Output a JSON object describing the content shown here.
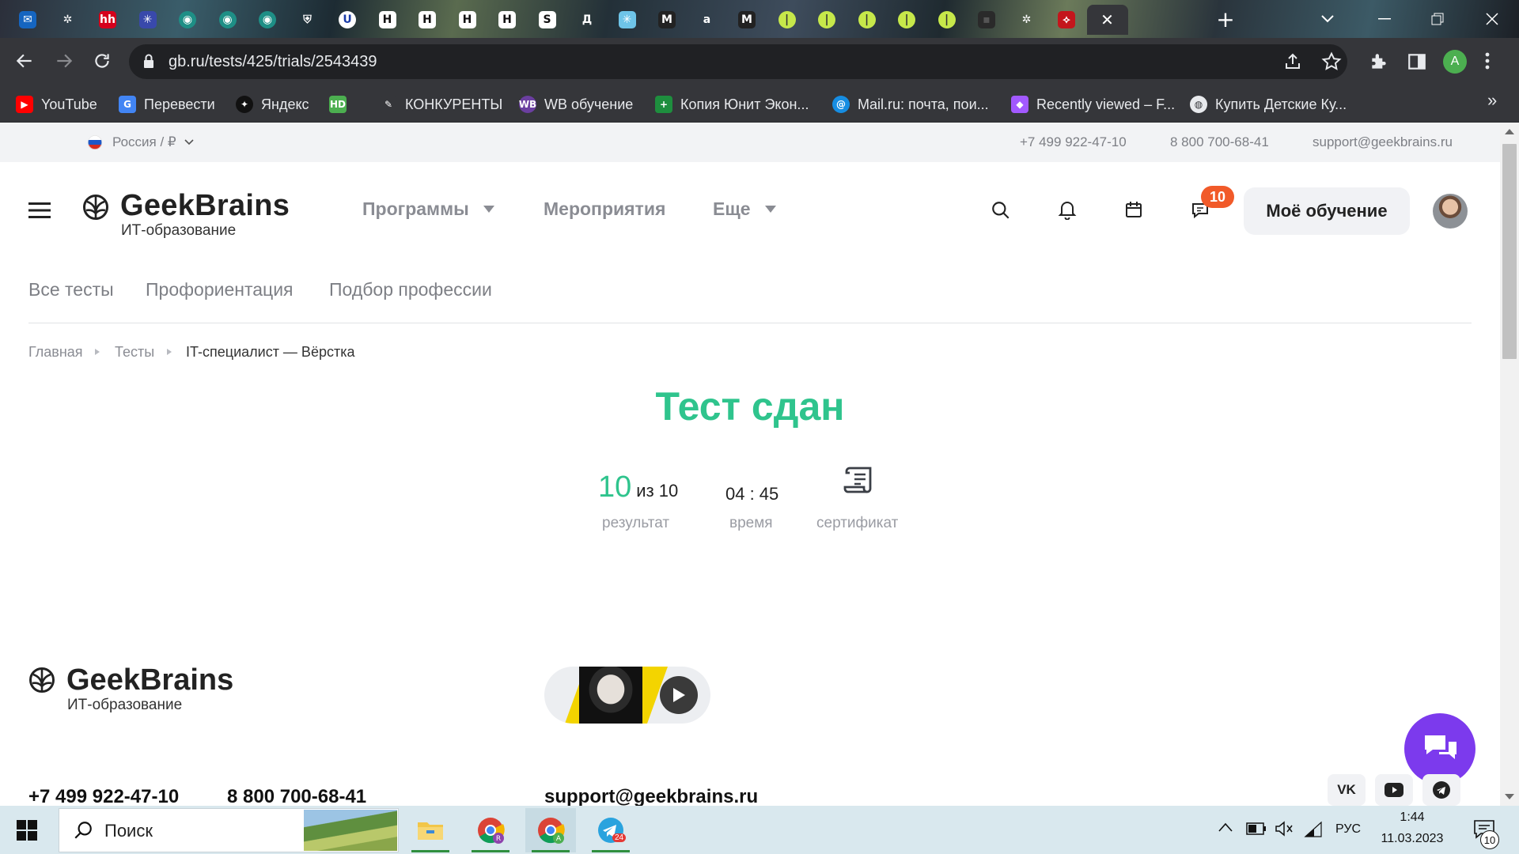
{
  "browser": {
    "tabs": [
      {
        "icon": "mail-icon",
        "glyph": "✉",
        "bg": "#1565c0",
        "fg": "#fff"
      },
      {
        "icon": "openai-icon",
        "glyph": "✲",
        "bg": "transparent",
        "fg": "#fff"
      },
      {
        "icon": "hh-icon",
        "glyph": "hh",
        "bg": "#d6001c",
        "fg": "#fff"
      },
      {
        "icon": "puzzle-icon",
        "glyph": "✳",
        "bg": "#3949ab",
        "fg": "#fff"
      },
      {
        "icon": "teal-circle-icon",
        "glyph": "◉",
        "bg": "#1e8f86",
        "fg": "#fff"
      },
      {
        "icon": "teal-circle-icon",
        "glyph": "◉",
        "bg": "#1e8f86",
        "fg": "#fff"
      },
      {
        "icon": "teal-circle-icon",
        "glyph": "◉",
        "bg": "#1e8f86",
        "fg": "#fff"
      },
      {
        "icon": "shield-icon",
        "glyph": "⛨",
        "bg": "transparent",
        "fg": "#fff"
      },
      {
        "icon": "u-icon",
        "glyph": "U",
        "bg": "#fff",
        "fg": "#1a3ca8"
      },
      {
        "icon": "h-icon",
        "glyph": "H",
        "bg": "#fff",
        "fg": "#111"
      },
      {
        "icon": "h-icon",
        "glyph": "H",
        "bg": "#fff",
        "fg": "#111"
      },
      {
        "icon": "h-icon",
        "glyph": "H",
        "bg": "#fff",
        "fg": "#111"
      },
      {
        "icon": "h-icon",
        "glyph": "H",
        "bg": "#fff",
        "fg": "#111"
      },
      {
        "icon": "link-icon",
        "glyph": "S",
        "bg": "#fff",
        "fg": "#111"
      },
      {
        "icon": "d-icon",
        "glyph": "Д",
        "bg": "transparent",
        "fg": "#fff"
      },
      {
        "icon": "sparkle-icon",
        "glyph": "✳",
        "bg": "#6ec4e8",
        "fg": "#fff"
      },
      {
        "icon": "m-icon",
        "glyph": "M",
        "bg": "#222",
        "fg": "#fff"
      },
      {
        "icon": "a-icon",
        "glyph": "a",
        "bg": "transparent",
        "fg": "#fff"
      },
      {
        "icon": "m-icon",
        "glyph": "M",
        "bg": "#222",
        "fg": "#fff"
      },
      {
        "icon": "lime-circle-icon",
        "glyph": "|",
        "bg": "#c6e84a",
        "fg": "#333"
      },
      {
        "icon": "lime-circle-icon",
        "glyph": "|",
        "bg": "#c6e84a",
        "fg": "#333"
      },
      {
        "icon": "lime-circle-icon",
        "glyph": "|",
        "bg": "#c6e84a",
        "fg": "#333"
      },
      {
        "icon": "lime-circle-icon",
        "glyph": "|",
        "bg": "#c6e84a",
        "fg": "#333"
      },
      {
        "icon": "lime-circle-icon",
        "glyph": "|",
        "bg": "#c6e84a",
        "fg": "#333"
      },
      {
        "icon": "dark-square-icon",
        "glyph": "▪",
        "bg": "#2a2a2a",
        "fg": "#555"
      },
      {
        "icon": "openai-icon",
        "glyph": "✲",
        "bg": "transparent",
        "fg": "#fff"
      },
      {
        "icon": "pdf-icon",
        "glyph": "⟡",
        "bg": "#c4161c",
        "fg": "#fff"
      }
    ],
    "active_tab_close": "✕",
    "new_tab": "+",
    "url": "gb.ru/tests/425/trials/2543439",
    "profile_initial": "A",
    "bookmarks": [
      {
        "label": "YouTube",
        "icon": "youtube-icon",
        "glyph": "▶",
        "color": "#ff0000"
      },
      {
        "label": "Перевести",
        "icon": "translate-icon",
        "glyph": "G",
        "color": "#4285f4"
      },
      {
        "label": "Яндекс",
        "icon": "yandex-icon",
        "glyph": "✦",
        "color": "#111"
      },
      {
        "label": "",
        "icon": "hd-icon",
        "glyph": "HD",
        "color": "#4caf50"
      },
      {
        "label": "КОНКУРЕНТЫ",
        "icon": "pen-icon",
        "glyph": "✎",
        "color": "#35363a"
      },
      {
        "label": "WB обучение",
        "icon": "wb-icon",
        "glyph": "WB",
        "color": "#6b3fa0"
      },
      {
        "label": "Копия Юнит Экон...",
        "icon": "sheets-icon",
        "glyph": "+",
        "color": "#1e8e3e"
      },
      {
        "label": "Mail.ru: почта, пои...",
        "icon": "mailru-icon",
        "glyph": "@",
        "color": "#168de2"
      },
      {
        "label": "Recently viewed – F...",
        "icon": "figma-icon",
        "glyph": "◆",
        "color": "#a259ff"
      },
      {
        "label": "Купить Детские Ку...",
        "icon": "globe-icon",
        "glyph": "◍",
        "color": "#e8eaed"
      }
    ],
    "bookmarks_more": "»"
  },
  "site": {
    "region": "Россия / ₽",
    "phone1": "+7 499 922-47-10",
    "phone2": "8 800 700-68-41",
    "email": "support@geekbrains.ru",
    "brand": "GeekBrains",
    "brand_sub": "ИТ-образование",
    "nav": [
      "Программы",
      "Мероприятия",
      "Еще"
    ],
    "notif_count": "10",
    "my_learning": "Моё обучение",
    "subnav": [
      "Все тесты",
      "Профориентация",
      "Подбор профессии"
    ],
    "breadcrumbs": [
      "Главная",
      "Тесты",
      "IT-специалист — Вёрстка"
    ],
    "result_title": "Тест сдан",
    "score": "10",
    "score_of": "из 10",
    "score_label": "результат",
    "time": "04 : 45",
    "time_label": "время",
    "cert_label": "сертификат",
    "footer_phone1": "+7 499 922-47-10",
    "footer_phone2": "8 800 700-68-41",
    "footer_email": "support@geekbrains.ru",
    "accent": "#2fc48d"
  },
  "taskbar": {
    "search_placeholder": "Поиск",
    "lang": "РУС",
    "time": "1:44",
    "date": "11.03.2023",
    "notifications": "10",
    "telegram_badge": "24"
  }
}
